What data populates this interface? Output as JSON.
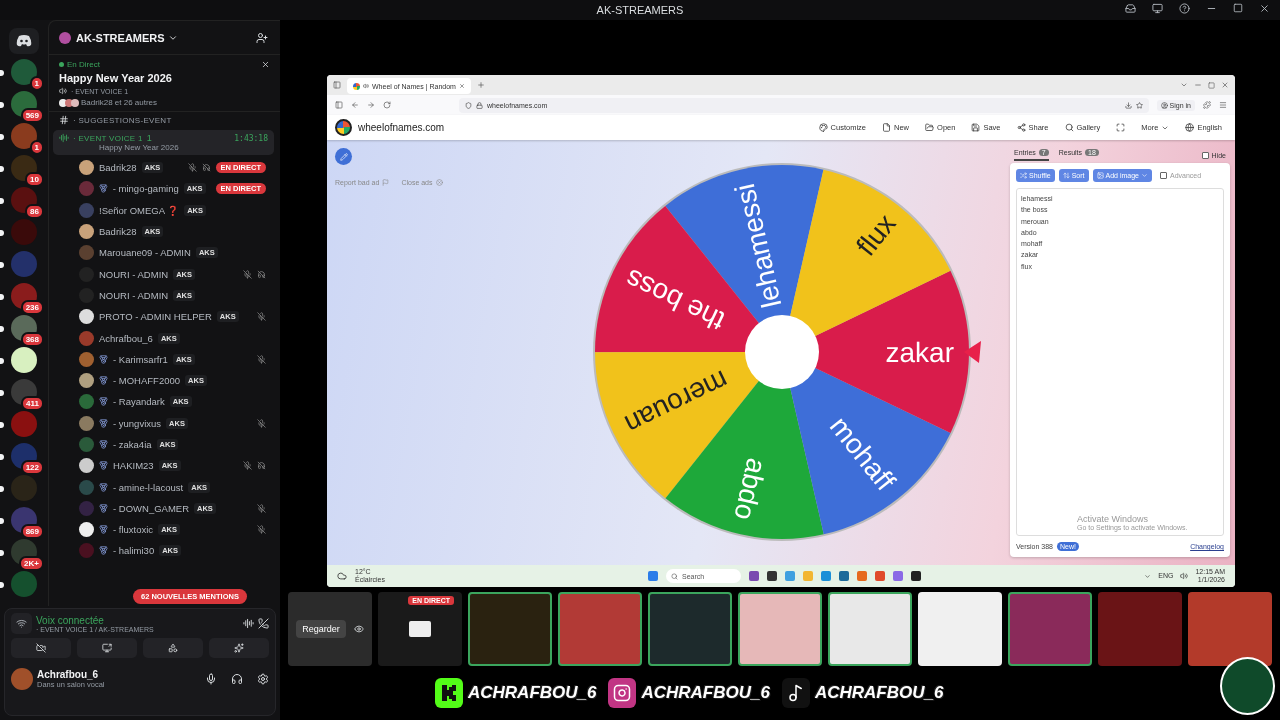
{
  "app_title": "AK-STREAMERS",
  "rail": [
    {
      "badge": "1",
      "unread": true,
      "color": "#1f5a3a"
    },
    {
      "badge": "569",
      "unread": true,
      "color": "#2b6b3c"
    },
    {
      "badge": "1",
      "unread": true,
      "color": "#8a3b1e"
    },
    {
      "badge": "10",
      "unread": true,
      "color": "#3a2a14"
    },
    {
      "badge": "86",
      "unread": true,
      "color": "#5a1010"
    },
    {
      "unread": true,
      "color": "#3a0a0a"
    },
    {
      "unread": true,
      "color": "#23306a"
    },
    {
      "badge": "236",
      "unread": true,
      "color": "#8a1c1c"
    },
    {
      "badge": "368",
      "unread": true,
      "color": "#5a6a5a"
    },
    {
      "unread": true,
      "color": "#d8f0c0"
    },
    {
      "badge": "411",
      "unread": true,
      "color": "#3a3a3a"
    },
    {
      "unread": true,
      "color": "#8a1010"
    },
    {
      "badge": "122",
      "unread": true,
      "color": "#1d2f6a"
    },
    {
      "unread": true,
      "color": "#2a2418"
    },
    {
      "badge": "869",
      "unread": true,
      "color": "#3a3570"
    },
    {
      "badge": "2K+",
      "unread": true,
      "color": "#2f3a2f"
    },
    {
      "unread": true,
      "color": "#15502e"
    }
  ],
  "server": {
    "name": "AK-STREAMERS"
  },
  "event": {
    "status": "En Direct",
    "title": "Happy New Year 2026",
    "channel": "· EVENT VOICE 1",
    "attendees": "Badrik28 et 26 autres"
  },
  "channels": [
    {
      "kind": "text",
      "name": "· SUGGESTIONS-EVENT",
      "selected": false
    },
    {
      "kind": "voice",
      "name": "· EVENT VOICE 1",
      "count": "1",
      "timer": "1:43:18",
      "subtitle": "Happy New Year 2026",
      "selected": true
    }
  ],
  "members": [
    {
      "name": "Badrik28",
      "medal": false,
      "tag": "AKS",
      "muted": true,
      "deafened": true,
      "badge": "EN DIRECT"
    },
    {
      "name": "- mingo-gaming",
      "medal": true,
      "tag": "AKS",
      "muted": false,
      "deafened": false,
      "badge": "EN DIRECT"
    },
    {
      "name": "!Señor OMEGA ❓",
      "medal": false,
      "tag": "AKS",
      "muted": false,
      "deafened": false
    },
    {
      "name": "Badrik28",
      "medal": false,
      "tag": "AKS",
      "muted": false,
      "deafened": false
    },
    {
      "name": "Marouane09 - ADMIN",
      "medal": false,
      "tag": "AKS",
      "muted": false,
      "deafened": false
    },
    {
      "name": "NOURI - ADMIN",
      "medal": false,
      "tag": "AKS",
      "muted": true,
      "deafened": true
    },
    {
      "name": "NOURI - ADMIN",
      "medal": false,
      "tag": "AKS",
      "muted": false,
      "deafened": false
    },
    {
      "name": "PROTO - ADMIN HELPER",
      "medal": false,
      "tag": "AKS",
      "muted": true,
      "deafened": false
    },
    {
      "name": "Achrafbou_6",
      "medal": false,
      "tag": "AKS",
      "muted": false,
      "deafened": false
    },
    {
      "name": "- Karimsarfr1",
      "medal": true,
      "tag": "AKS",
      "muted": true,
      "deafened": false
    },
    {
      "name": "- MOHAFF2000",
      "medal": true,
      "tag": "AKS",
      "muted": false,
      "deafened": false
    },
    {
      "name": "- Rayandark",
      "medal": true,
      "tag": "AKS",
      "muted": false,
      "deafened": false
    },
    {
      "name": "- yungvixus",
      "medal": true,
      "tag": "AKS",
      "muted": true,
      "deafened": false
    },
    {
      "name": "- zaka4ia",
      "medal": true,
      "tag": "AKS",
      "muted": false,
      "deafened": false
    },
    {
      "name": "HAKIM23",
      "medal": true,
      "tag": "AKS",
      "muted": true,
      "deafened": true
    },
    {
      "name": "- amine-l-lacoust",
      "medal": true,
      "tag": "AKS",
      "muted": false,
      "deafened": false
    },
    {
      "name": "- DOWN_GAMER",
      "medal": true,
      "tag": "AKS",
      "muted": true,
      "deafened": false
    },
    {
      "name": "- fluxtoxic",
      "medal": true,
      "tag": "AKS",
      "muted": true,
      "deafened": false
    },
    {
      "name": "- halimi30",
      "medal": true,
      "tag": "AKS",
      "muted": false,
      "deafened": false
    }
  ],
  "mentions": "62 NOUVELLES MENTIONS",
  "voice_panel": {
    "status": "Voix connectée",
    "channel": "· EVENT VOICE 1 / AK-STREAMERS"
  },
  "user": {
    "name": "Achrafbou_6",
    "status": "Dans un salon vocal"
  },
  "browser": {
    "tab": "Wheel of Names | Random",
    "url": "wheelofnames.com",
    "sign_in": "Sign in",
    "site": "wheelofnames.com",
    "nav": [
      {
        "kind": "customize",
        "label": "Customize"
      },
      {
        "kind": "new",
        "label": "New"
      },
      {
        "kind": "open",
        "label": "Open"
      },
      {
        "kind": "save",
        "label": "Save"
      },
      {
        "kind": "share",
        "label": "Share"
      },
      {
        "kind": "gallery",
        "label": "Gallery"
      },
      {
        "kind": "fullscreen"
      },
      {
        "kind": "more",
        "label": "More"
      },
      {
        "kind": "language",
        "label": "English"
      }
    ],
    "ad_links": [
      "Report bad ad",
      "Close ads"
    ],
    "wheel": [
      {
        "label": "lehamessi",
        "color": "#3e6ed8"
      },
      {
        "label": "the boss",
        "color": "#d91c4b"
      },
      {
        "label": "merouan",
        "color": "#f1c21b"
      },
      {
        "label": "abdo",
        "color": "#1ea83a"
      },
      {
        "label": "mohaff",
        "color": "#3e6ed8"
      },
      {
        "label": "zakar",
        "color": "#d91c4b"
      },
      {
        "label": "flux",
        "color": "#f1c21b"
      }
    ],
    "tabs": [
      {
        "label": "Entries",
        "count": "7",
        "selected": true
      },
      {
        "label": "Results",
        "count": "18",
        "selected": false
      }
    ],
    "hide": {
      "label": "Hide",
      "checked": false
    },
    "tools": [
      {
        "kind": "shuffle",
        "label": "Shuffle"
      },
      {
        "kind": "sort",
        "label": "Sort"
      },
      {
        "kind": "image",
        "label": "Add image"
      }
    ],
    "advanced": {
      "label": "Advanced",
      "checked": false
    },
    "entries": [
      "lehamessi",
      "the boss",
      "merouan",
      "abdo",
      "mohaff",
      "zakar",
      "flux"
    ],
    "activation": [
      "Activate Windows",
      "Go to Settings to activate Windows."
    ],
    "version": "Version 388",
    "new_badge": "New!",
    "changelog": "Changelog",
    "taskbar": {
      "temp": "12°C",
      "weather": "Éclaircies",
      "search": "Search",
      "lang": "ENG",
      "time": "12:15 AM",
      "date": "1/1/2026"
    }
  },
  "tiles": [
    {
      "kind": "watch",
      "label": "Regarder",
      "color": "#2b2b2b",
      "speaking": false
    },
    {
      "kind": "stream",
      "label": "EN DIRECT",
      "color": "#1a1a1a",
      "speaking": false
    },
    {
      "kind": "user",
      "color": "#2a2210",
      "speaking": true
    },
    {
      "kind": "user",
      "color": "#b23a36",
      "speaking": true
    },
    {
      "kind": "user",
      "color": "#1d2a2c",
      "speaking": true
    },
    {
      "kind": "user",
      "color": "#e6b8b8",
      "speaking": true
    },
    {
      "kind": "user",
      "color": "#e8e8e8",
      "speaking": true
    },
    {
      "kind": "user",
      "color": "#f0f0f0",
      "speaking": false
    },
    {
      "kind": "user",
      "color": "#8a2a5a",
      "speaking": true
    },
    {
      "kind": "user",
      "color": "#6a1416",
      "speaking": false
    },
    {
      "kind": "user",
      "color": "#b33a2a",
      "speaking": false
    }
  ],
  "socials": [
    {
      "kind": "kick",
      "handle": "ACHRAFBOU_6"
    },
    {
      "kind": "instagram",
      "handle": "ACHRAFBOU_6"
    },
    {
      "kind": "tiktok",
      "handle": "ACHRAFBOU_6"
    }
  ]
}
